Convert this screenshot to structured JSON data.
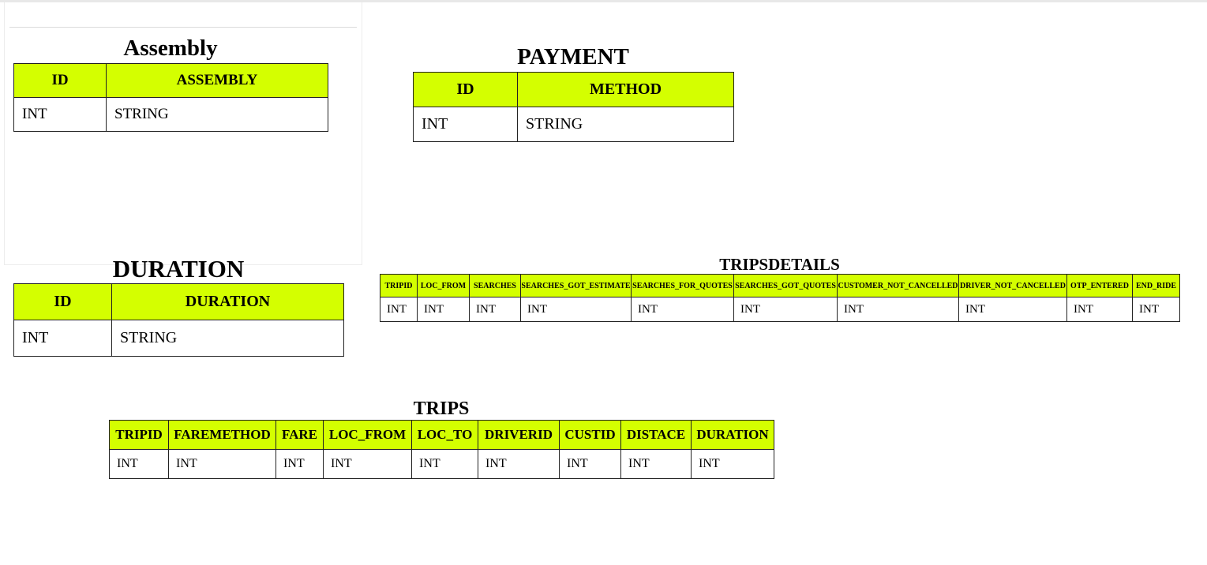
{
  "tables": {
    "assembly": {
      "title": "Assembly",
      "headers": [
        "ID",
        "ASSEMBLY"
      ],
      "types": [
        "INT",
        "STRING"
      ]
    },
    "payment": {
      "title": "PAYMENT",
      "headers": [
        "ID",
        "METHOD"
      ],
      "types": [
        "INT",
        "STRING"
      ]
    },
    "duration": {
      "title": "DURATION",
      "headers": [
        "ID",
        "DURATION"
      ],
      "types": [
        "INT",
        "STRING"
      ]
    },
    "tripsdetails": {
      "title": "TRIPSDETAILS",
      "headers": [
        "TRIPID",
        "LOC_FROM",
        "SEARCHES",
        "SEARCHES_GOT_ESTIMATE",
        "SEARCHES_FOR_QUOTES",
        "SEARCHES_GOT_QUOTES",
        "CUSTOMER_NOT_CANCELLED",
        "DRIVER_NOT_CANCELLED",
        "OTP_ENTERED",
        "END_RIDE"
      ],
      "types": [
        "INT",
        "INT",
        "INT",
        "INT",
        "INT",
        "INT",
        "INT",
        "INT",
        "INT",
        "INT"
      ]
    },
    "trips": {
      "title": "TRIPS",
      "headers": [
        "TRIPID",
        "FAREMETHOD",
        "FARE",
        "LOC_FROM",
        "LOC_TO",
        "DRIVERID",
        "CUSTID",
        "DISTACE",
        "DURATION"
      ],
      "types": [
        "INT",
        "INT",
        "INT",
        "INT",
        "INT",
        "INT",
        "INT",
        "INT",
        "INT"
      ]
    }
  },
  "colors": {
    "header_bg": "#d4ff00",
    "border": "#222222"
  }
}
